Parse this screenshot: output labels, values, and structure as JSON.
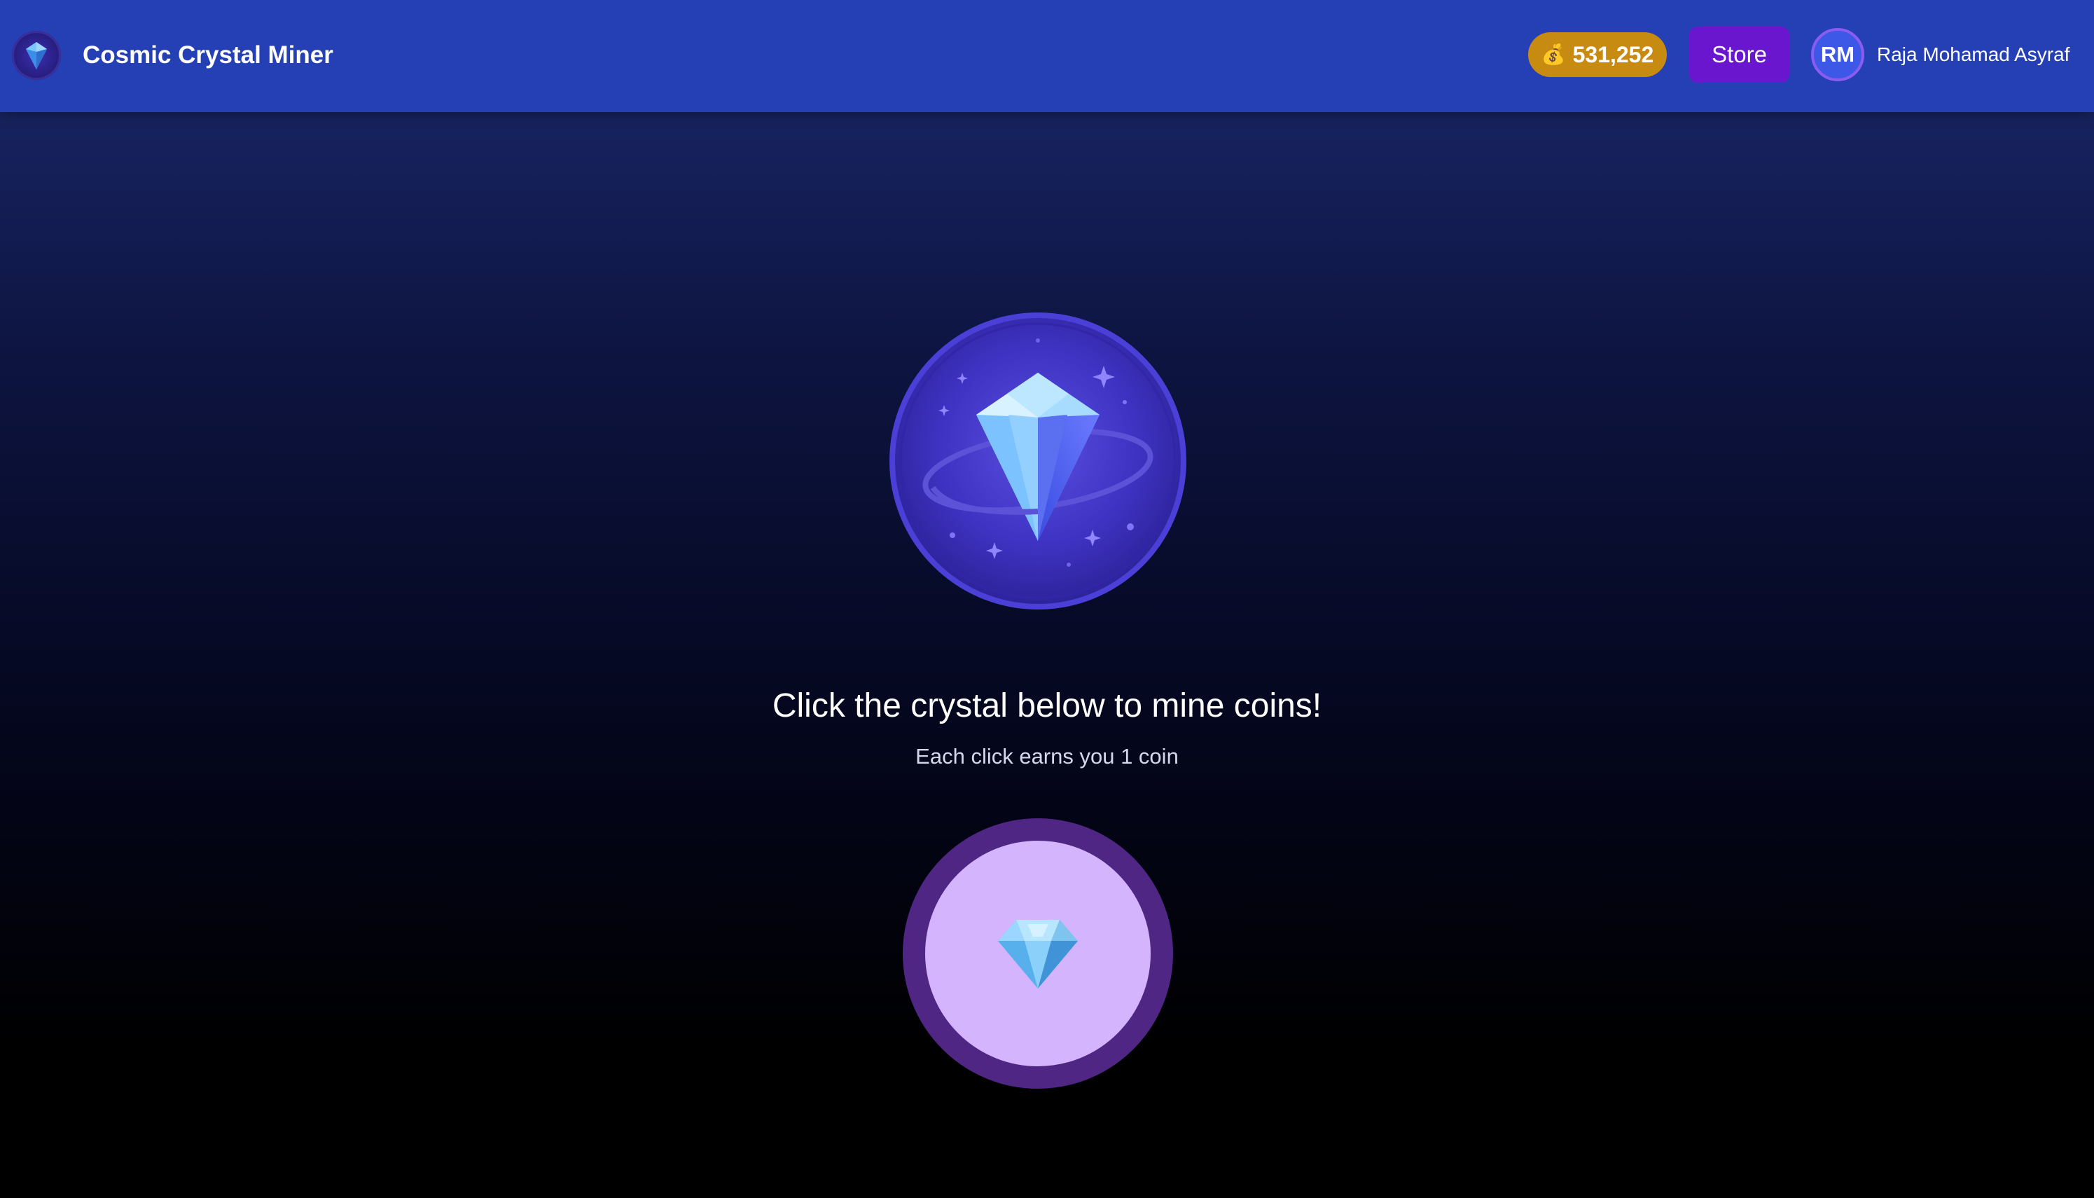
{
  "header": {
    "app_title": "Cosmic Crystal Miner",
    "logo_icon": "gem-icon",
    "coins": {
      "icon": "money-bag-icon",
      "icon_glyph": "💰",
      "value": "531,252"
    },
    "store_label": "Store",
    "user": {
      "initials": "RM",
      "name": "Raja Mohamad Asyraf"
    }
  },
  "main": {
    "hero_icon": "crystal-planet-icon",
    "headline": "Click the crystal below to mine coins!",
    "subline": "Each click earns you 1 coin",
    "mine_button_icon": "gem-icon"
  },
  "colors": {
    "header_bg": "#2440b4",
    "coin_badge": "#c88b12",
    "store_button": "#6a16cf",
    "mine_button_inner": "#d3b4fd",
    "mine_button_ring": "#4f2683"
  }
}
